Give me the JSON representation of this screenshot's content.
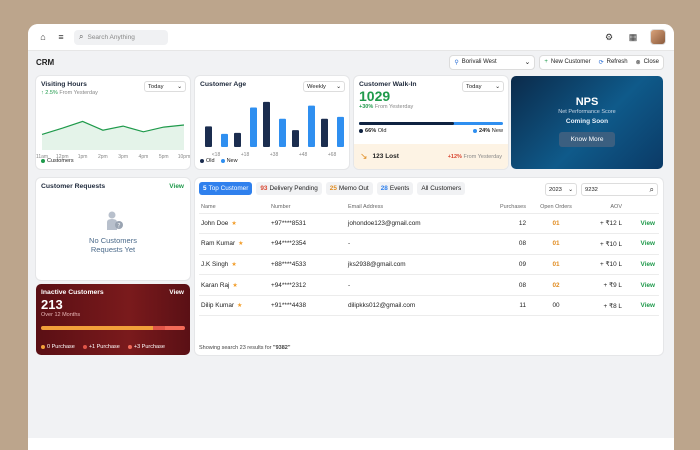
{
  "topbar": {
    "search_placeholder": "Search Anything",
    "home_icon": "home-icon",
    "menu_icon": "menu-icon",
    "settings_icon": "gear-icon",
    "apps_icon": "grid-icon"
  },
  "header": {
    "title": "CRM",
    "location": "Borivali West",
    "new_customer": "New Customer",
    "refresh": "Refresh",
    "close": "Close"
  },
  "visiting_hours": {
    "title": "Visiting Hours",
    "change": "2.5%",
    "change_suffix": "From Yesterday",
    "period": "Today",
    "legend": "Customers",
    "chart_data": {
      "type": "area",
      "categories": [
        "11am",
        "12pm",
        "1pm",
        "2pm",
        "3pm",
        "4pm",
        "5pm",
        "10pm"
      ],
      "values": [
        30,
        42,
        55,
        38,
        46,
        35,
        44,
        48
      ],
      "ylim": [
        0,
        100
      ]
    }
  },
  "customer_age": {
    "title": "Customer Age",
    "period": "Weekly",
    "legend_old": "Old",
    "legend_new": "New",
    "chart_data": {
      "type": "bar",
      "categories": [
        "<18",
        "+18",
        "+38",
        "+48",
        "+68"
      ],
      "series": [
        {
          "name": "Old",
          "values": [
            22,
            15,
            48,
            18,
            30
          ]
        },
        {
          "name": "New",
          "values": [
            14,
            42,
            30,
            44,
            32
          ]
        }
      ],
      "ylim": [
        0,
        50
      ]
    }
  },
  "walk_in": {
    "title": "Customer Walk-In",
    "value": "1029",
    "change": "+30%",
    "change_suffix": "From Yesterday",
    "period": "Today",
    "old_pct": "66%",
    "old_label": "Old",
    "new_pct": "24%",
    "new_label": "New",
    "old_fraction": 0.66,
    "lost_value": "123 Lost",
    "lost_change": "+12%",
    "lost_suffix": "From Yesterday"
  },
  "nps": {
    "title": "NPS",
    "subtitle": "Net Performance Score",
    "status": "Coming Soon",
    "button": "Know More"
  },
  "requests": {
    "title": "Customer Requests",
    "view": "View",
    "empty_line1": "No Customers",
    "empty_line2": "Requests Yet"
  },
  "inactive": {
    "title": "Inactive Customers",
    "value": "213",
    "period": "Over 12 Months",
    "view": "View",
    "legend": [
      "0 Purchase",
      "+1 Purchase",
      "+3 Purchase"
    ],
    "segments": [
      0.78,
      0.08,
      0.14
    ],
    "colors": [
      "#f2a03a",
      "#e05548",
      "#f26a58"
    ]
  },
  "tabs": [
    {
      "count": "5",
      "label": "Top Customer"
    },
    {
      "count": "93",
      "label": "Delivery Pending"
    },
    {
      "count": "25",
      "label": "Memo Out"
    },
    {
      "count": "28",
      "label": "Events"
    },
    {
      "count": "",
      "label": "All Customers"
    }
  ],
  "filter": {
    "year": "2023",
    "search_value": "9232"
  },
  "table": {
    "headers": [
      "Name",
      "Number",
      "Email Address",
      "Purchases",
      "Open Orders",
      "AOV",
      ""
    ],
    "rows": [
      {
        "name": "John Doe",
        "number": "+97****8531",
        "email": "johondoe123@gmail.com",
        "purchases": "12",
        "orders": "01",
        "aov": "+ ₹12 L",
        "view": "View"
      },
      {
        "name": "Ram Kumar",
        "number": "+94****2354",
        "email": "-",
        "purchases": "08",
        "orders": "01",
        "aov": "+ ₹10 L",
        "view": "View"
      },
      {
        "name": "J.K Singh",
        "number": "+88****4533",
        "email": "jks2938@gmail.com",
        "purchases": "09",
        "orders": "01",
        "aov": "+ ₹10 L",
        "view": "View"
      },
      {
        "name": "Karan Raj",
        "number": "+94****2312",
        "email": "-",
        "purchases": "08",
        "orders": "02",
        "aov": "+ ₹9 L",
        "view": "View"
      },
      {
        "name": "Dilip Kumar",
        "number": "+91****4438",
        "email": "dilipkks012@gmail.com",
        "purchases": "11",
        "orders": "00",
        "aov": "+ ₹8 L",
        "view": "View"
      }
    ],
    "footer_prefix": "Showing search 23 results for",
    "footer_query": "\"9382\""
  }
}
